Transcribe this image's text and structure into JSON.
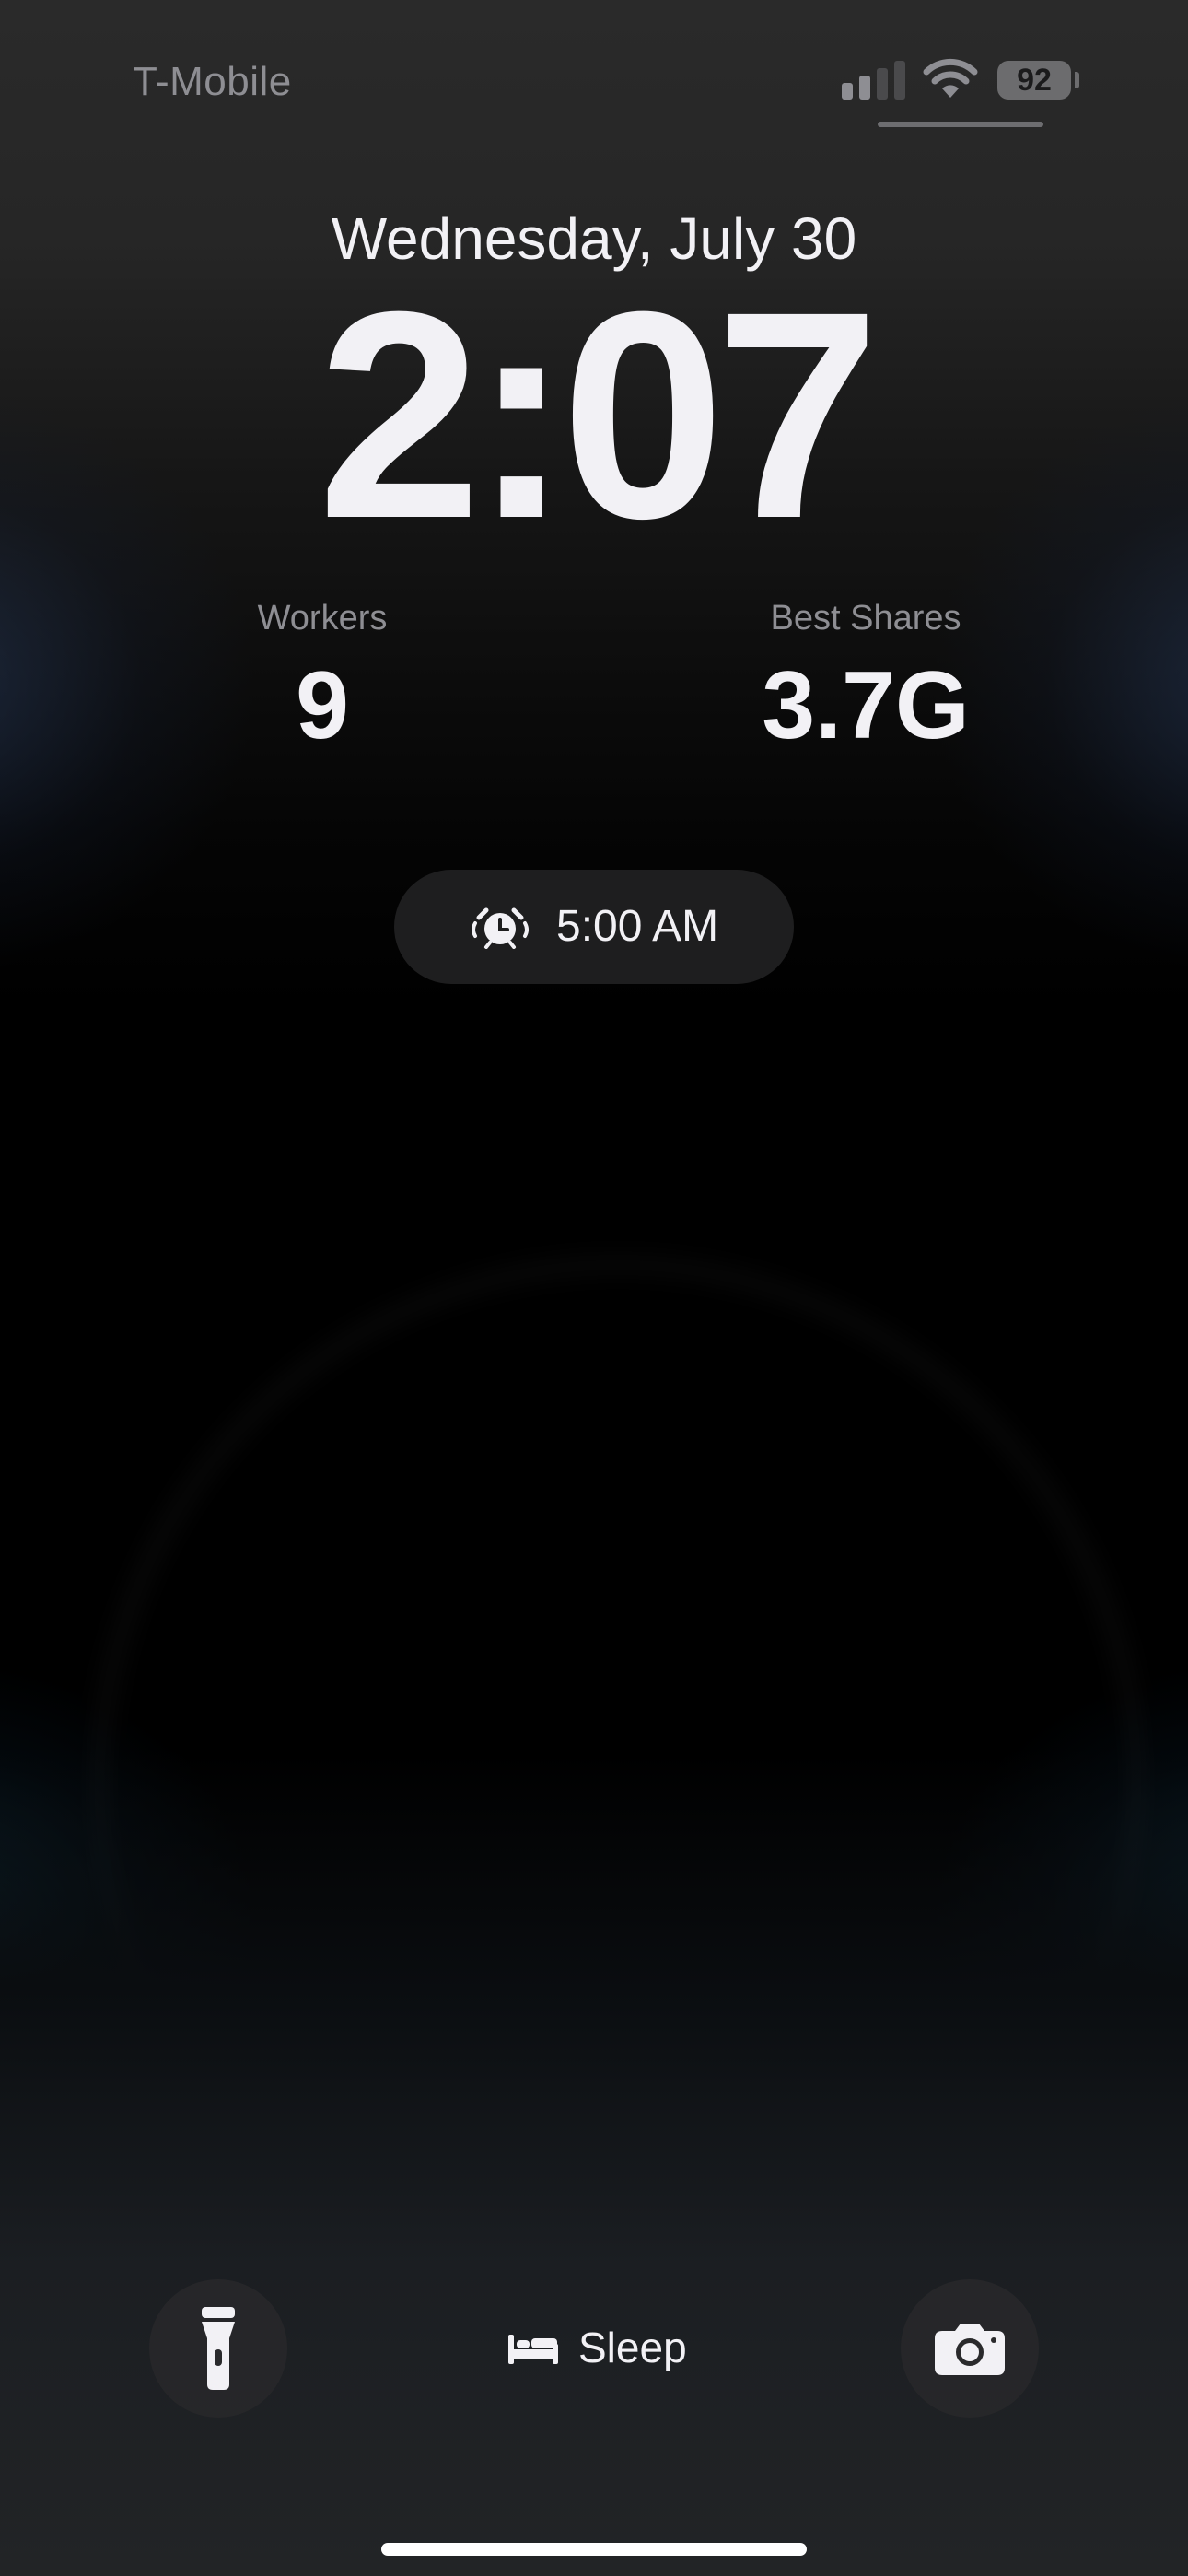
{
  "status_bar": {
    "carrier": "T-Mobile",
    "signal_bars_active": 2,
    "signal_bars_total": 4,
    "battery_percent": "92",
    "icons": [
      "cellular-signal-icon",
      "wifi-icon",
      "battery-icon"
    ]
  },
  "lock_screen": {
    "date": "Wednesday, July 30",
    "time": "2:07"
  },
  "widgets": [
    {
      "label": "Workers",
      "value": "9"
    },
    {
      "label": "Best Shares",
      "value": "3.7G"
    }
  ],
  "alarm": {
    "icon": "alarm-clock-icon",
    "time": "5:00 AM"
  },
  "bottom_controls": {
    "flashlight_icon": "flashlight-icon",
    "sleep_icon": "bed-icon",
    "sleep_label": "Sleep",
    "camera_icon": "camera-icon"
  },
  "colors": {
    "text_primary": "#f2f1f5",
    "text_secondary": "#8e8e93",
    "pill_background": "#1e1e1f",
    "battery_fill": "#6c6c6e"
  }
}
